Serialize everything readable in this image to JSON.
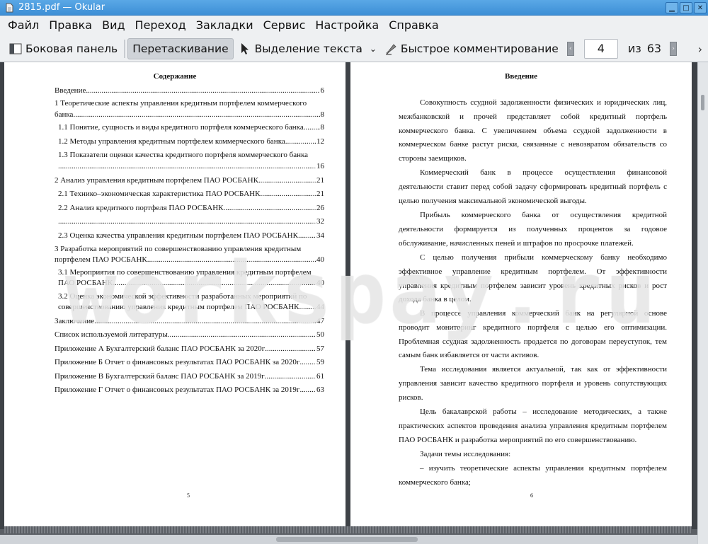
{
  "window": {
    "title": "2815.pdf — Okular"
  },
  "menu": [
    "Файл",
    "Правка",
    "Вид",
    "Переход",
    "Закладки",
    "Сервис",
    "Настройка",
    "Справка"
  ],
  "toolbar": {
    "sidebar": "Боковая панель",
    "browse": "Перетаскивание",
    "text_select": "Выделение текста",
    "annotate": "Быстрое комментирование",
    "page_current": "4",
    "page_of": "из",
    "page_total": "63"
  },
  "left_page": {
    "heading": "Содержание",
    "entries": [
      {
        "title": "Введение",
        "page": "6"
      },
      {
        "title_line1": "1 Теоретические аспекты управления кредитным портфелем коммерческого",
        "title": "банка",
        "page": "8"
      },
      {
        "title": "1.1 Понятие, сущность и виды кредитного портфеля коммерческого банка",
        "page": "8"
      },
      {
        "title": "1.2 Методы управления кредитным портфелем коммерческого банка",
        "page": "12"
      },
      {
        "title_line1": "1.3 Показатели оценки качества кредитного портфеля коммерческого банка",
        "title": "",
        "page": "16"
      },
      {
        "title": "2 Анализ управления кредитным портфелем ПАО РОСБАНК",
        "page": "21"
      },
      {
        "title": "2.1 Технико–экономическая характеристика ПАО РОСБАНК",
        "page": "21"
      },
      {
        "title": "2.2 Анализ кредитного портфеля ПАО РОСБАНК",
        "page": "26"
      },
      {
        "title": "",
        "page": "32"
      },
      {
        "title": "2.3 Оценка качества управления кредитным портфелем ПАО РОСБАНК",
        "page": "34"
      },
      {
        "title_line1": "3 Разработка мероприятий по совершенствованию управления кредитным",
        "title": "портфелем ПАО РОСБАНК",
        "page": "40"
      },
      {
        "title_line1": "3.1 Мероприятия по совершенствованию управления кредитным портфелем",
        "title": "ПАО РОСБАНК",
        "page": "40"
      },
      {
        "title_line1": "3.2 Оценка экономической эффективности разработанных мероприятий по",
        "title": "совершенствованию управления кредитным портфелем ПАО РОСБАНК",
        "page": "44"
      },
      {
        "title": "Заключение",
        "page": "47"
      },
      {
        "title": "Список используемой литературы",
        "page": "50"
      },
      {
        "title": "Приложение А Бухгалтерский баланс ПАО РОСБАНК за 2020г",
        "page": "57"
      },
      {
        "title": "Приложение Б Отчет о финансовых результатах ПАО РОСБАНК за 2020г",
        "page": "59"
      },
      {
        "title": "Приложение В Бухгалтерский баланс ПАО РОСБАНК за 2019г",
        "page": "61"
      },
      {
        "title": "Приложение Г Отчет о финансовых результатах ПАО РОСБАНК за 2019г",
        "page": "63"
      }
    ],
    "page_number": "5"
  },
  "right_page": {
    "heading": "Введение",
    "paragraphs": [
      [
        "Совокупность ссудной задолженности физических и юридических лиц,",
        "межбанковской и прочей представляет собой кредитный портфель",
        "коммерческого банка. С увеличением объема ссудной задолженности в",
        "коммерческом банке растут риски, связанные с невозвратом обязательств со",
        "стороны заемщиков."
      ],
      [
        "Коммерческий банк в процессе осуществления финансовой",
        "деятельности ставит перед собой задачу сформировать кредитный портфель с",
        "целью получения максимальной экономической выгоды."
      ],
      [
        "Прибыль коммерческого банка от осуществления кредитной",
        "деятельности формируется из полученных процентов за годовое",
        "обслуживание, начисленных пеней и штрафов по просрочке платежей."
      ],
      [
        "С целью получения прибыли коммерческому банку необходимо",
        "эффективное управление кредитным портфелем. От эффективности",
        "управления кредитным портфелем зависит уровень кредитных рисков и рост",
        "дохода банка в целом."
      ],
      [
        "В процессе управления коммерческий банк на регулярной основе",
        "проводит мониторинг кредитного портфеля с целью его оптимизации.",
        "Проблемная ссудная задолженность продается по договорам переуступок, тем",
        "самым банк избавляется от части активов."
      ],
      [
        "Тема исследования является актуальной, так как от эффективности",
        "управления зависит качество кредитного портфеля и уровень сопутствующих",
        "рисков."
      ],
      [
        "Цель бакалаврской работы – исследование методических, а также",
        "практических аспектов проведения анализа управления кредитным портфелем",
        "ПАО РОСБАНК и разработка мероприятий по его совершенствованию."
      ],
      [
        "Задачи темы исследования:"
      ],
      [
        "–      изучить теоретические аспекты управления кредитным портфелем",
        "коммерческого банка;"
      ]
    ],
    "page_number": "6"
  },
  "watermark": "workspay.ru"
}
